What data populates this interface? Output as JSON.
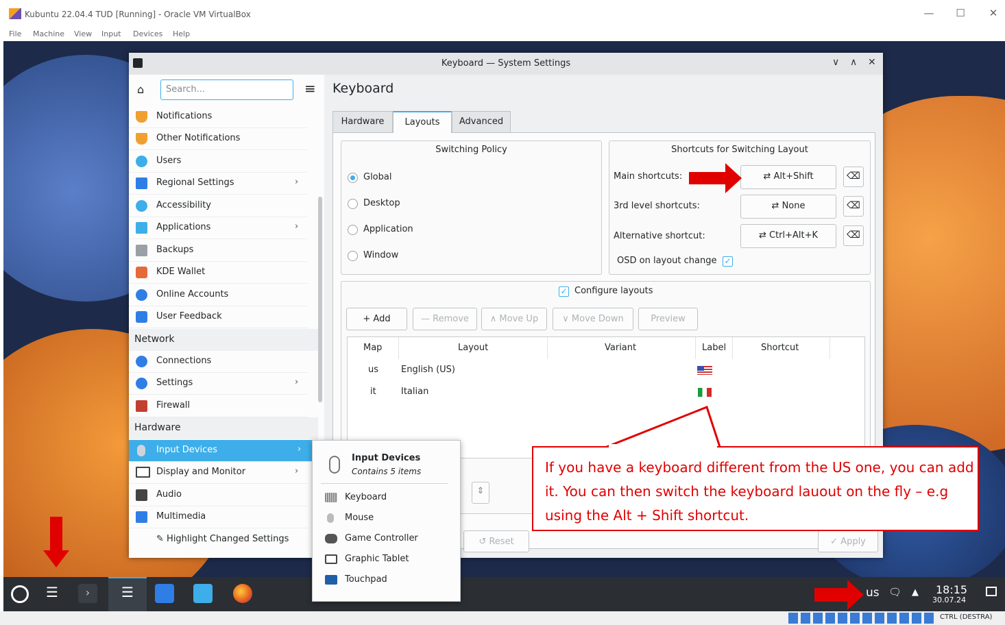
{
  "vbox": {
    "title": "Kubuntu 22.04.4 TUD [Running] - Oracle VM VirtualBox",
    "menu": [
      "File",
      "Machine",
      "View",
      "Input",
      "Devices",
      "Help"
    ],
    "host_key": "CTRL (DESTRA)"
  },
  "window": {
    "title": "Keyboard — System Settings"
  },
  "sidebar": {
    "search_placeholder": "Search...",
    "items_personal": [
      {
        "label": "Notifications",
        "icon": "bell-icon",
        "color": "#f0a030"
      },
      {
        "label": "Other Notifications",
        "icon": "bell-icon",
        "color": "#f0a030"
      },
      {
        "label": "Users",
        "icon": "user-icon",
        "color": "#3daee9"
      },
      {
        "label": "Regional Settings",
        "icon": "flag-icon",
        "color": "#2f7ee6"
      },
      {
        "label": "Accessibility",
        "icon": "accessibility-icon",
        "color": "#3daee9"
      },
      {
        "label": "Applications",
        "icon": "grid-icon",
        "color": "#3daee9"
      },
      {
        "label": "Backups",
        "icon": "backup-icon",
        "color": "#9aa0a6"
      },
      {
        "label": "KDE Wallet",
        "icon": "wallet-icon",
        "color": "#e56a3a"
      },
      {
        "label": "Online Accounts",
        "icon": "globe-icon",
        "color": "#2f7ee6"
      },
      {
        "label": "User Feedback",
        "icon": "chat-icon",
        "color": "#2f7ee6"
      }
    ],
    "network_header": "Network",
    "items_network": [
      {
        "label": "Connections",
        "icon": "globe-icon",
        "color": "#2f7ee6"
      },
      {
        "label": "Settings",
        "icon": "globe-icon",
        "color": "#2f7ee6"
      },
      {
        "label": "Firewall",
        "icon": "firewall-icon",
        "color": "#c2402f"
      }
    ],
    "hardware_header": "Hardware",
    "items_hardware": [
      {
        "label": "Input Devices",
        "icon": "mouse-icon",
        "color": "#d0d4d8"
      },
      {
        "label": "Display and Monitor",
        "icon": "monitor-icon",
        "color": "#555"
      },
      {
        "label": "Audio",
        "icon": "speaker-icon",
        "color": "#444"
      },
      {
        "label": "Multimedia",
        "icon": "multimedia-icon",
        "color": "#2f7ee6"
      }
    ],
    "highlight_label": "Highlight Changed Settings"
  },
  "page": {
    "heading": "Keyboard",
    "tabs": [
      "Hardware",
      "Layouts",
      "Advanced"
    ],
    "switching_policy": {
      "title": "Switching Policy",
      "options": [
        "Global",
        "Desktop",
        "Application",
        "Window"
      ],
      "selected": "Global"
    },
    "shortcuts": {
      "title": "Shortcuts for Switching Layout",
      "main_label": "Main shortcuts:",
      "main_value": "Alt+Shift",
      "third_label": "3rd level shortcuts:",
      "third_value": "None",
      "alt_label": "Alternative shortcut:",
      "alt_value": "Ctrl+Alt+K",
      "osd_label": "OSD on layout change"
    },
    "configure_layouts": "Configure layouts",
    "toolbar": {
      "add": "+ Add",
      "remove": "— Remove",
      "move_up": "∧ Move Up",
      "move_down": "∨ Move Down",
      "preview": "Preview"
    },
    "table": {
      "headers": [
        "Map",
        "Layout",
        "Variant",
        "Label",
        "Shortcut"
      ],
      "rows": [
        {
          "map": "us",
          "layout": "English (US)",
          "flag": "us-flag-icon"
        },
        {
          "map": "it",
          "layout": "Italian",
          "flag": "it-flag-icon"
        }
      ]
    },
    "reset": "Reset",
    "apply": "Apply"
  },
  "popup": {
    "title": "Input Devices",
    "subtitle": "Contains 5 items",
    "items": [
      "Keyboard",
      "Mouse",
      "Game Controller",
      "Graphic Tablet",
      "Touchpad"
    ]
  },
  "taskbar": {
    "keyboard_layout": "us",
    "time": "18:15",
    "date": "30.07.24"
  },
  "annotation": {
    "text": "If you have a keyboard different from the US one, you can add it. You can then switch the keyboard lauout on the fly – e.g using the Alt + Shift shortcut.",
    "color": "#e00000"
  }
}
